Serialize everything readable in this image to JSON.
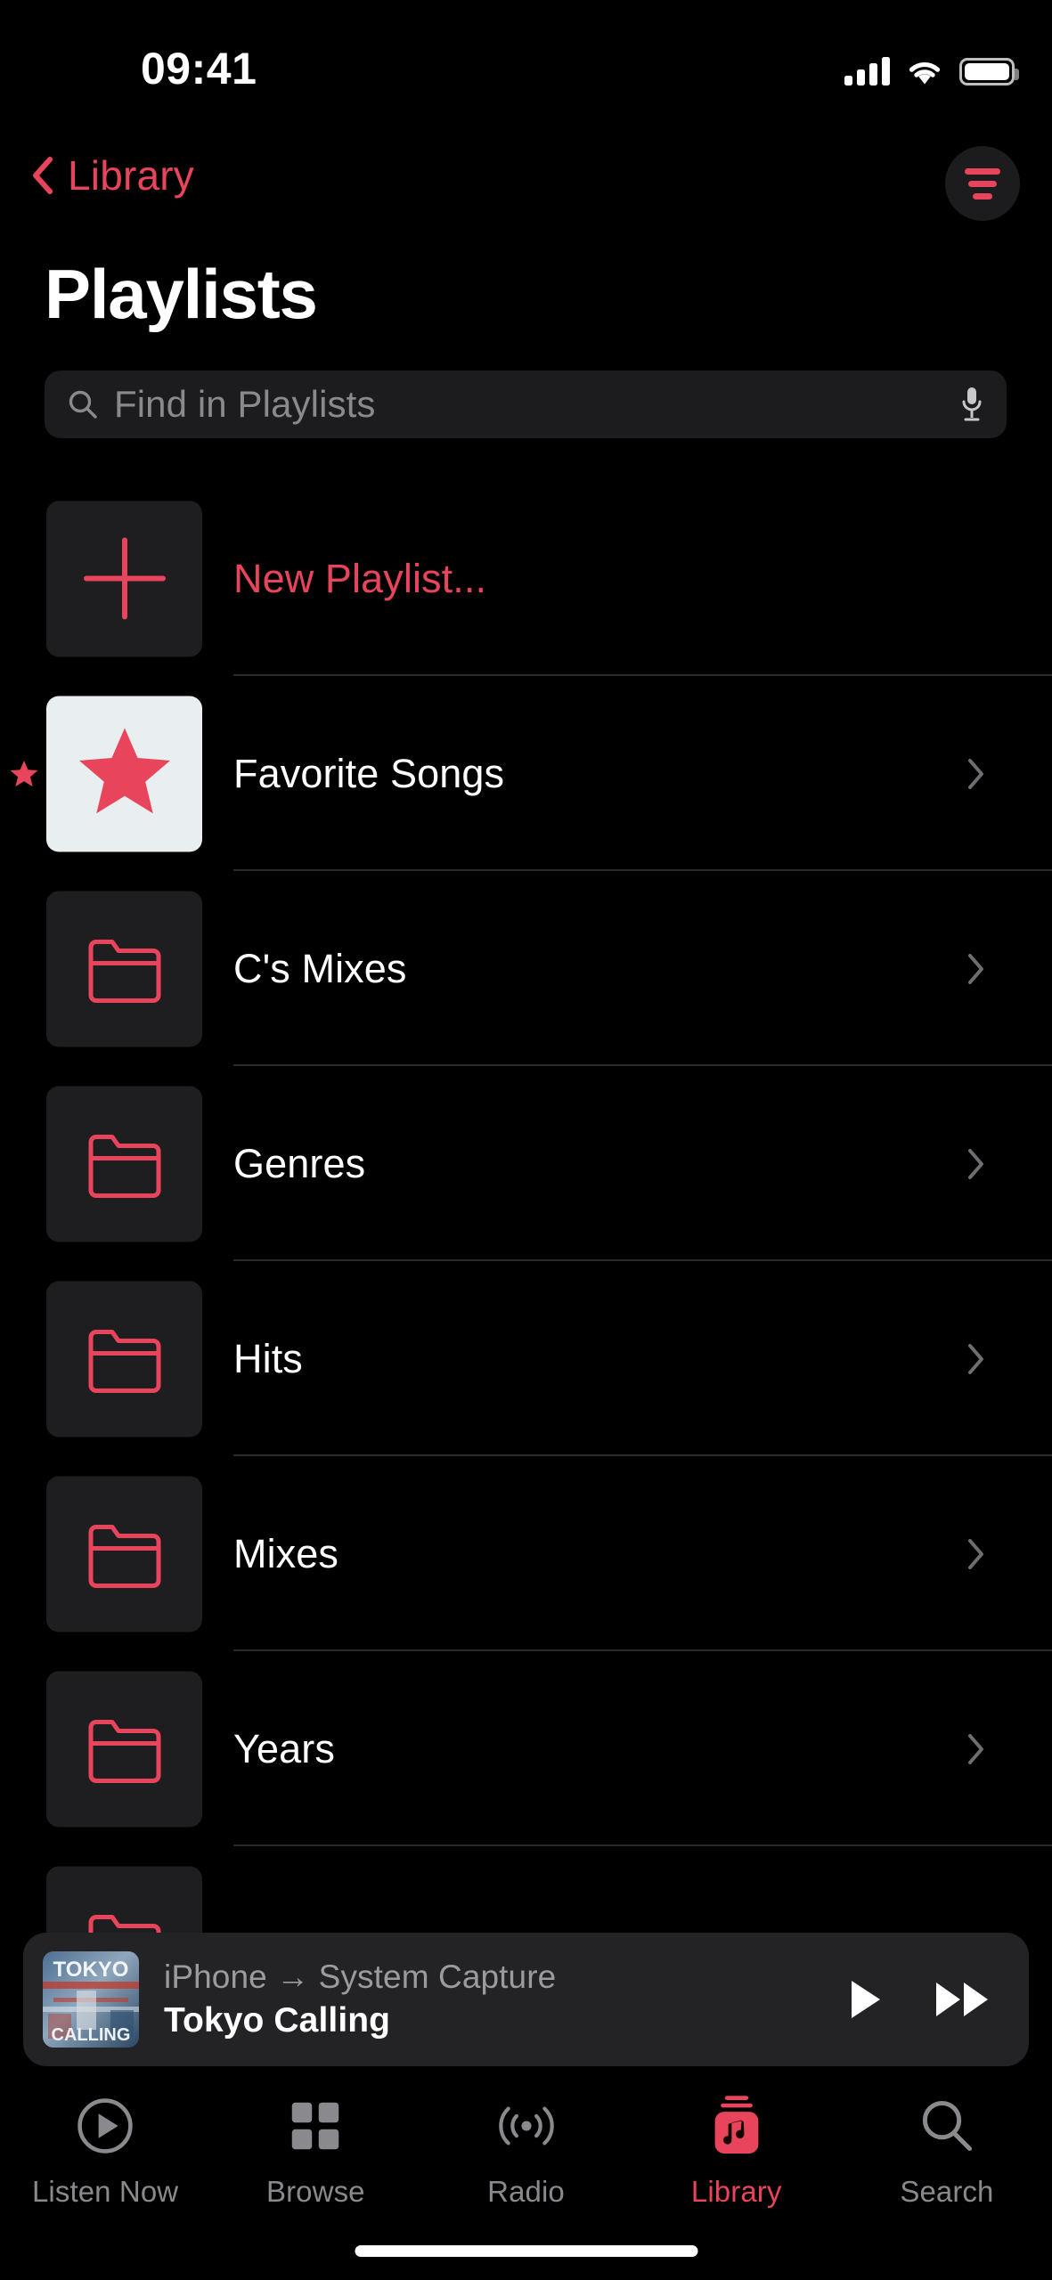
{
  "status_bar": {
    "time": "09:41",
    "cellular_icon": "cellular-signal-icon",
    "wifi_icon": "wifi-icon",
    "battery_icon": "battery-full-icon",
    "signal_bars": 4
  },
  "nav": {
    "back_label": "Library",
    "back_icon": "chevron-left-icon",
    "sort_icon": "sort-filter-icon"
  },
  "page_title": "Playlists",
  "search": {
    "placeholder": "Find in Playlists",
    "value": "",
    "search_icon": "search-icon",
    "mic_icon": "microphone-icon"
  },
  "playlists": [
    {
      "label": "New Playlist...",
      "icon": "plus-icon",
      "accent": true,
      "chevron": false,
      "pinned": false,
      "artwork": "dark-tile"
    },
    {
      "label": "Favorite Songs",
      "icon": "star-icon",
      "accent": false,
      "chevron": true,
      "pinned": true,
      "artwork": "light-tile"
    },
    {
      "label": "C's Mixes",
      "icon": "folder-icon",
      "accent": false,
      "chevron": true,
      "pinned": false,
      "artwork": "dark-tile"
    },
    {
      "label": "Genres",
      "icon": "folder-icon",
      "accent": false,
      "chevron": true,
      "pinned": false,
      "artwork": "dark-tile"
    },
    {
      "label": "Hits",
      "icon": "folder-icon",
      "accent": false,
      "chevron": true,
      "pinned": false,
      "artwork": "dark-tile"
    },
    {
      "label": "Mixes",
      "icon": "folder-icon",
      "accent": false,
      "chevron": true,
      "pinned": false,
      "artwork": "dark-tile"
    },
    {
      "label": "Years",
      "icon": "folder-icon",
      "accent": false,
      "chevron": true,
      "pinned": false,
      "artwork": "dark-tile"
    },
    {
      "label": "",
      "icon": "folder-icon",
      "accent": false,
      "chevron": false,
      "pinned": false,
      "artwork": "dark-tile"
    }
  ],
  "now_playing": {
    "route": "iPhone → System Capture",
    "track": "Tokyo Calling",
    "artwork_title": "TOKYO CALLING",
    "play_icon": "play-icon",
    "forward_icon": "fast-forward-icon"
  },
  "tabs": [
    {
      "label": "Listen Now",
      "icon": "play-circle-icon",
      "active": false
    },
    {
      "label": "Browse",
      "icon": "grid-squares-icon",
      "active": false
    },
    {
      "label": "Radio",
      "icon": "broadcast-waves-icon",
      "active": false
    },
    {
      "label": "Library",
      "icon": "music-library-icon",
      "active": true
    },
    {
      "label": "Search",
      "icon": "search-icon",
      "active": false
    }
  ],
  "colors": {
    "background": "#000000",
    "accent_red": "#E8445B",
    "tile_dark": "#1E1E20",
    "tile_light": "#E9EEF0",
    "separator": "#2A2A2C",
    "secondary_text": "#8A8A8E",
    "now_playing_bg": "#232325"
  }
}
